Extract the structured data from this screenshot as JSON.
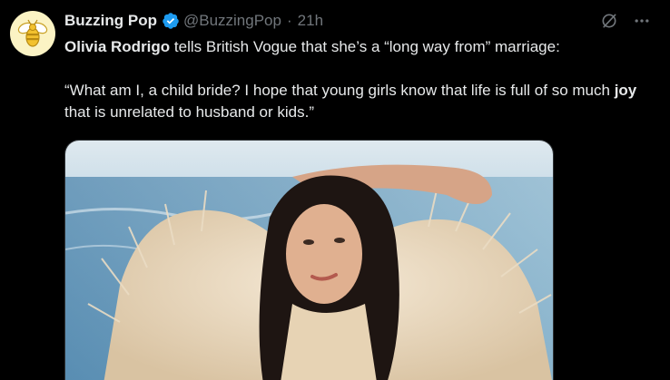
{
  "tweet": {
    "author": {
      "display_name": "Buzzing Pop",
      "handle": "@BuzzingPop",
      "verified_icon": "verified-badge-icon",
      "avatar_icon": "bee-icon"
    },
    "separator": "·",
    "time": "21h",
    "text": {
      "name_bold": "Olivia Rodrigo",
      "line1_rest": " tells British Vogue that she’s a “long way from” marriage:",
      "quote_start": "“What am I, a child bride? I hope that young girls know that life is full of so much ",
      "quote_bold": "joy",
      "quote_end": " that is unrelated to husband or kids.”"
    },
    "media": {
      "icon": "photo-image"
    }
  },
  "colors": {
    "background": "#000000",
    "text": "#e7e9ea",
    "muted": "#71767b",
    "verified": "#1d9bf0",
    "avatar_bg": "#fbf3c4"
  }
}
